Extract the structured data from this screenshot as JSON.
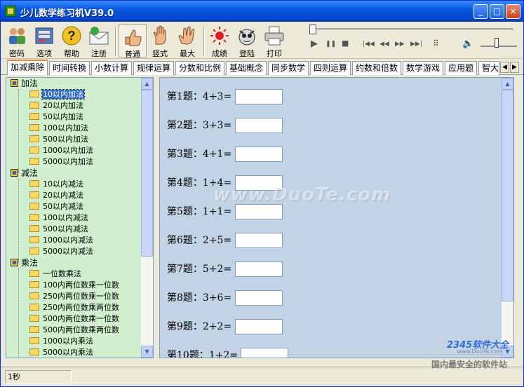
{
  "window": {
    "title": "少儿数学练习机V39.0",
    "controls": [
      "_",
      "□",
      "×"
    ]
  },
  "toolbar": {
    "buttons": [
      {
        "label": "密码",
        "icon": "users-icon"
      },
      {
        "label": "选项",
        "icon": "options-icon"
      },
      {
        "label": "帮助",
        "icon": "help-icon"
      },
      {
        "label": "注册",
        "icon": "register-icon"
      },
      {
        "label": "普通",
        "icon": "thumb-icon"
      },
      {
        "label": "竖式",
        "icon": "hand-icon"
      },
      {
        "label": "最大",
        "icon": "hand-max-icon"
      },
      {
        "label": "成绩",
        "icon": "score-icon"
      },
      {
        "label": "登陆",
        "icon": "login-icon"
      },
      {
        "label": "打印",
        "icon": "printer-icon"
      }
    ]
  },
  "media": {
    "play": "▶",
    "pause": "❚❚",
    "stop": "■",
    "first": "|◀◀",
    "prev": "◀◀",
    "next": "▶▶",
    "last": "▶▶|",
    "list": "⠿",
    "volume": "🔈"
  },
  "tabs": {
    "items": [
      "加减乘除",
      "时间转换",
      "小数计算",
      "规律运算",
      "分数和比例",
      "基础概念",
      "同步数学",
      "四则运算",
      "约数和倍数",
      "数学游戏",
      "应用题",
      "智大"
    ],
    "selected_index": 0
  },
  "tree": {
    "groups": [
      {
        "label": "加法",
        "items": [
          "10以内加法",
          "20以内加法",
          "50以内加法",
          "100以内加法",
          "500以内加法",
          "1000以内加法",
          "5000以内加法"
        ]
      },
      {
        "label": "减法",
        "items": [
          "10以内减法",
          "20以内减法",
          "50以内减法",
          "100以内减法",
          "500以内减法",
          "1000以内减法",
          "5000以内减法"
        ]
      },
      {
        "label": "乘法",
        "items": [
          "一位数乘法",
          "100内两位数乘一位数",
          "250内两位数乘一位数",
          "250内两位数乘两位数",
          "500内两位数乘一位数",
          "500内两位数乘两位数",
          "1000以内乘法",
          "5000以内乘法"
        ]
      }
    ],
    "selected": "10以内加法"
  },
  "questions": [
    "第1题：4+3=",
    "第2题：3+3=",
    "第3题：4+1=",
    "第4题：1+4=",
    "第5题：1+1=",
    "第6题：2+5=",
    "第7题：5+2=",
    "第8题：3+6=",
    "第9题：2+2=",
    "第10题：1+2="
  ],
  "watermark": "www.DuoTe.com",
  "watermark2": {
    "logo": "2345软件大全",
    "sub": "www.DuoTe.com",
    "tag": "国内最安全的软件站"
  },
  "status": {
    "time": "1秒"
  }
}
